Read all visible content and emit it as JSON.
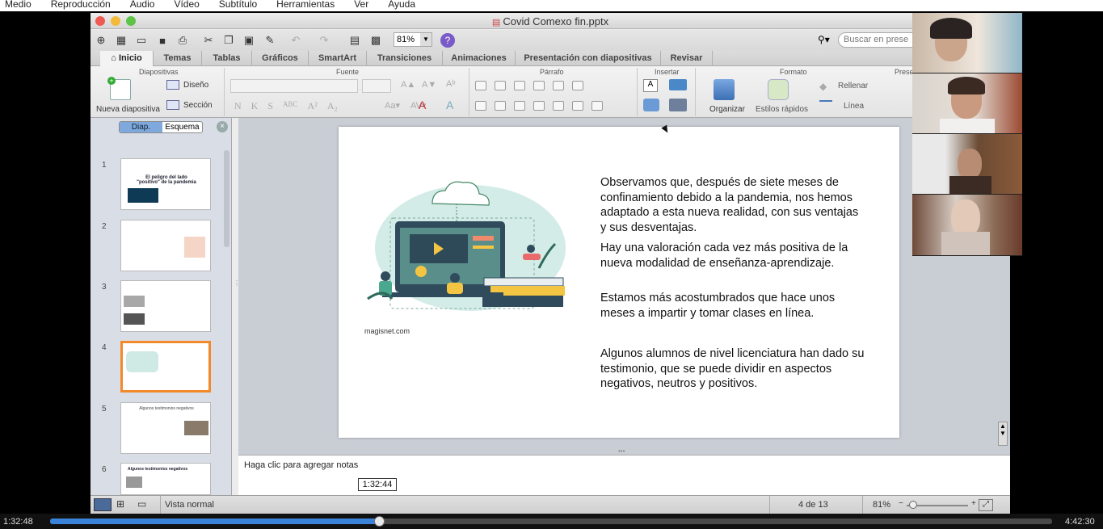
{
  "vlc_menu": [
    "Medio",
    "Reproducción",
    "Audio",
    "Vídeo",
    "Subtítulo",
    "Herramientas",
    "Ver",
    "Ayuda"
  ],
  "window": {
    "title": "Covid Comexo fin.pptx"
  },
  "toolbar": {
    "zoom": "81%",
    "search_placeholder": "Buscar en prese"
  },
  "tabs": [
    "Inicio",
    "Temas",
    "Tablas",
    "Gráficos",
    "SmartArt",
    "Transiciones",
    "Animaciones",
    "Presentación con diapositivas",
    "Revisar"
  ],
  "ribbon": {
    "groups": {
      "diapositivas": "Diapositivas",
      "fuente": "Fuente",
      "parrafo": "Párrafo",
      "insertar": "Insertar",
      "formato": "Formato",
      "presentacion": "Prese"
    },
    "nueva_diapositiva": "Nueva diapositiva",
    "diseno": "Diseño",
    "seccion": "Sección",
    "organizar": "Organizar",
    "estilos_rapidos": "Estilos rápidos",
    "rellenar": "Rellenar",
    "linea": "Línea",
    "font_buttons": [
      "N",
      "K",
      "S",
      "ABC",
      "A²",
      "A₂"
    ]
  },
  "left_panel": {
    "view_diap": "Diap.",
    "view_esquema": "Esquema",
    "slide_numbers": [
      "1",
      "2",
      "3",
      "4",
      "5",
      "6"
    ],
    "thumb1_title": "El peligro del lado \"positivo\" de la pandemia",
    "thumb5_title": "Algunos testimonios negativos",
    "thumb6_title": "Algunos testimonios negativos"
  },
  "slide": {
    "paragraphs": [
      "Observamos que, después de siete meses de confinamiento debido a la pandemia, nos hemos adaptado a esta nueva realidad, con sus ventajas y sus desventajas.",
      "Hay una valoración cada vez más positiva de la nueva modalidad de enseñanza-aprendizaje.",
      "Estamos más acostumbrados que hace unos meses a impartir y tomar clases en línea.",
      "Algunos alumnos de nivel licenciatura han dado su testimonio, que se puede dividir en aspectos negativos, neutros y positivos."
    ],
    "credit": "magisnet.com"
  },
  "notes": {
    "placeholder": "Haga clic para agregar notas"
  },
  "status": {
    "view": "Vista normal",
    "slide_count": "4 de 13",
    "zoom": "81%"
  },
  "player": {
    "elapsed": "1:32:48",
    "tooltip": "1:32:44",
    "total": "4:42:30",
    "progress": 0.328
  },
  "colors": {
    "accent_orange": "#f28a2a",
    "slide_teal": "#cfe9e4",
    "progress_blue": "#3b82d9"
  }
}
